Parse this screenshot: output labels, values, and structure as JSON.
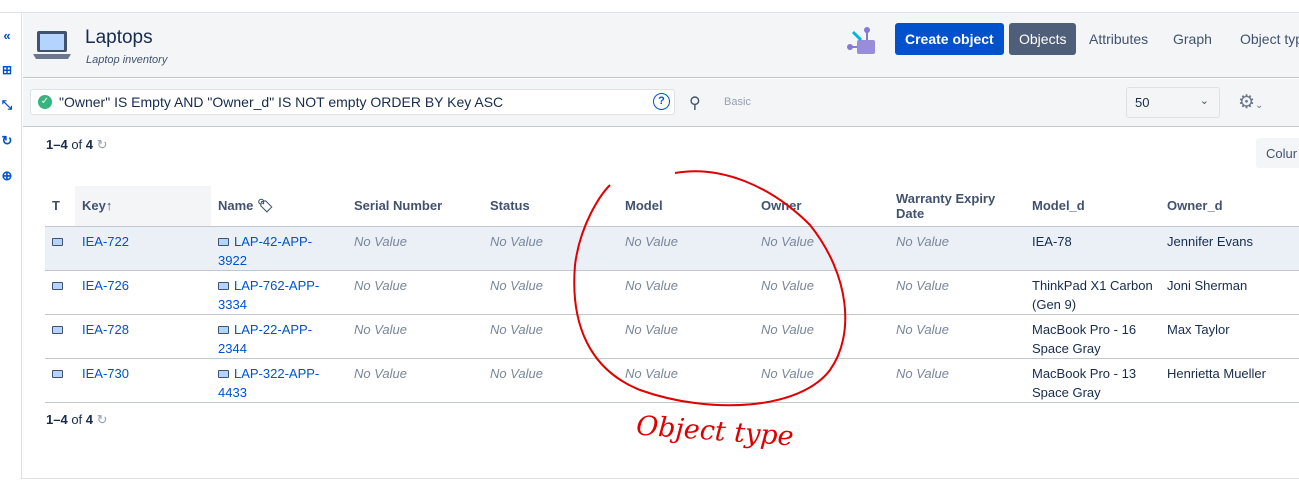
{
  "header": {
    "title": "Laptops",
    "subtitle": "Laptop inventory",
    "create_label": "Create object",
    "tabs": [
      "Objects",
      "Attributes",
      "Graph",
      "Object typ"
    ]
  },
  "search": {
    "query": "\"Owner\" IS Empty AND \"Owner_d\" IS NOT empty ORDER BY Key ASC",
    "mode_label": "Basic",
    "page_size": "50"
  },
  "results": {
    "range": "1–4",
    "of": "of",
    "total": "4",
    "columns_button": "Colur"
  },
  "table": {
    "columns": [
      "T",
      "Key",
      "Name",
      "Serial Number",
      "Status",
      "Model",
      "Owner",
      "Warranty Expiry Date",
      "Model_d",
      "Owner_d"
    ],
    "rows": [
      {
        "key": "IEA-722",
        "name": "LAP-42-APP-3922",
        "serial": "No Value",
        "status": "No Value",
        "model": "No Value",
        "owner": "No Value",
        "warranty": "No Value",
        "model_d": "IEA-78",
        "owner_d": "Jennifer Evans"
      },
      {
        "key": "IEA-726",
        "name": "LAP-762-APP-3334",
        "serial": "No Value",
        "status": "No Value",
        "model": "No Value",
        "owner": "No Value",
        "warranty": "No Value",
        "model_d": "ThinkPad X1 Carbon (Gen 9)",
        "owner_d": "Joni Sherman"
      },
      {
        "key": "IEA-728",
        "name": "LAP-22-APP-2344",
        "serial": "No Value",
        "status": "No Value",
        "model": "No Value",
        "owner": "No Value",
        "warranty": "No Value",
        "model_d": "MacBook Pro - 16 Space Gray",
        "owner_d": "Max Taylor"
      },
      {
        "key": "IEA-730",
        "name": "LAP-322-APP-4433",
        "serial": "No Value",
        "status": "No Value",
        "model": "No Value",
        "owner": "No Value",
        "warranty": "No Value",
        "model_d": "MacBook Pro - 13 Space Gray",
        "owner_d": "Henrietta Mueller"
      }
    ]
  },
  "annotation": {
    "text": "Object type",
    "color": "#e00000"
  }
}
